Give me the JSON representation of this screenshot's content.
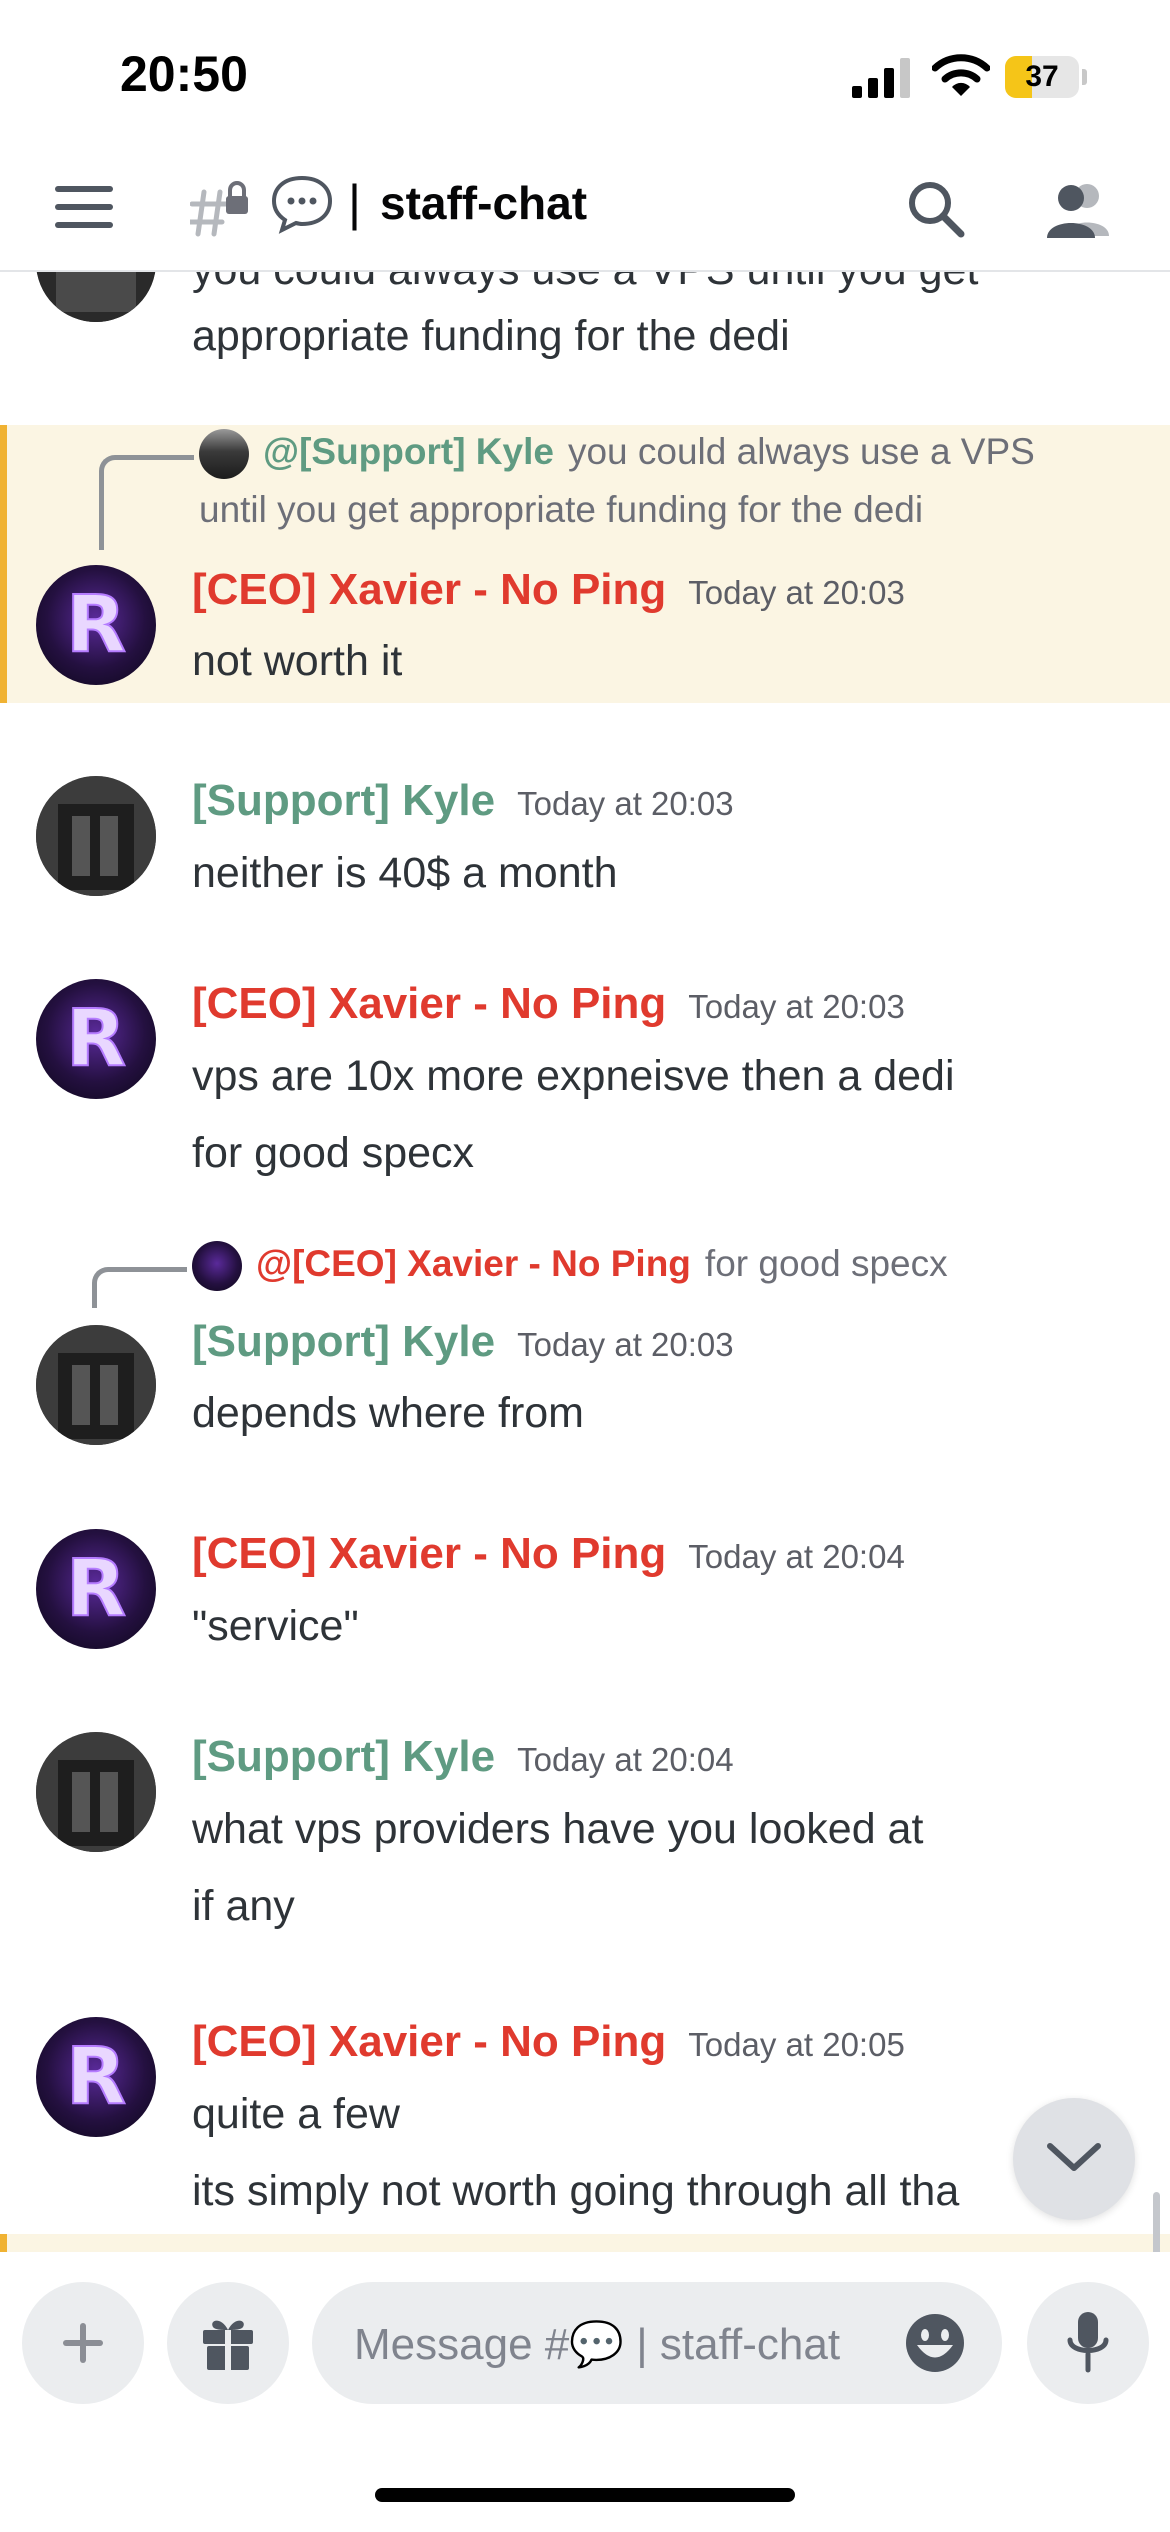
{
  "status_bar": {
    "time": "20:50",
    "battery": "37",
    "battery_level": 0.37
  },
  "header": {
    "separator": "|",
    "channel_name": "staff-chat"
  },
  "messages": [
    {
      "lines": [
        "you could always use a VPS until you get",
        "appropriate funding for the dedi"
      ]
    },
    {
      "reply": {
        "author": "@[Support] Kyle",
        "text_line1": "you could always use a VPS",
        "text_line2": "until you get appropriate funding for the dedi"
      },
      "author": "[CEO] Xavier - No Ping",
      "timestamp": "Today at 20:03",
      "lines": [
        "not worth it"
      ]
    },
    {
      "author": "[Support] Kyle",
      "timestamp": "Today at 20:03",
      "lines": [
        "neither is 40$ a month"
      ]
    },
    {
      "author": "[CEO] Xavier - No Ping",
      "timestamp": "Today at 20:03",
      "lines": [
        "vps are 10x more expneisve then a dedi",
        "for good specx"
      ]
    },
    {
      "reply": {
        "author": "@[CEO] Xavier - No Ping",
        "text": "for good specx"
      },
      "author": "[Support] Kyle",
      "timestamp": "Today at 20:03",
      "lines": [
        "depends where from"
      ]
    },
    {
      "author": "[CEO] Xavier - No Ping",
      "timestamp": "Today at 20:04",
      "lines": [
        "\"service\""
      ]
    },
    {
      "author": "[Support] Kyle",
      "timestamp": "Today at 20:04",
      "lines": [
        "what vps providers have you looked at",
        "if any"
      ]
    },
    {
      "author": "[CEO] Xavier - No Ping",
      "timestamp": "Today at 20:05",
      "lines": [
        "quite a few",
        "its simply not worth going through all tha"
      ]
    }
  ],
  "composer": {
    "placeholder": "Message #💬 | staff-chat"
  },
  "colors": {
    "ceo_name": "#e03a2e",
    "kyle_name": "#5f9b82",
    "mention_highlight_bg": "#fbf5e3",
    "mention_highlight_bar": "#f0b232",
    "battery_fill": "#f5c518"
  }
}
